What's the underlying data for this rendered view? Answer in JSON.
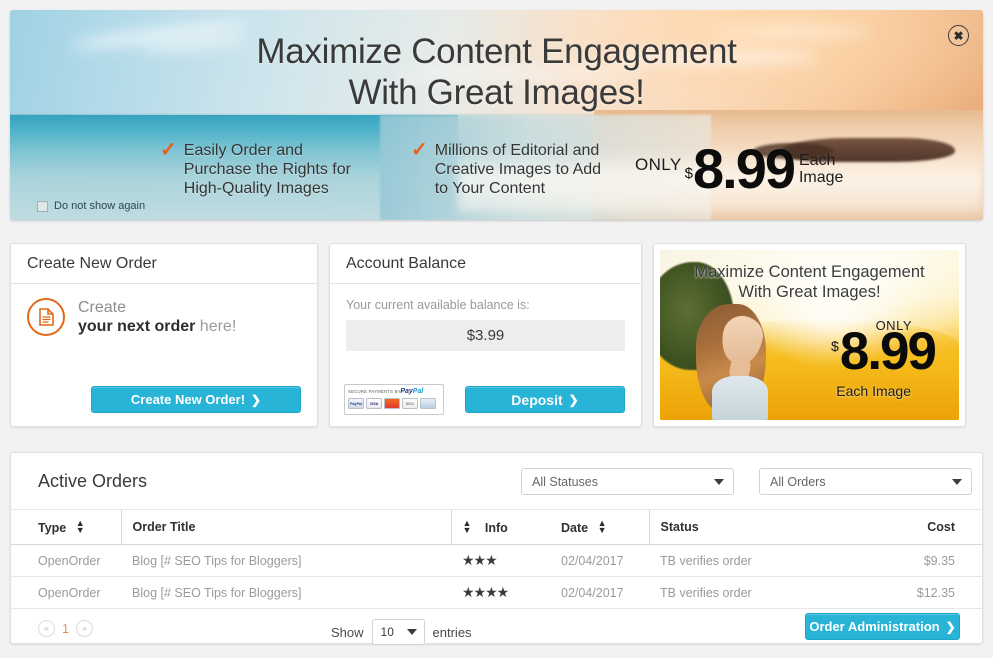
{
  "banner": {
    "headline_line1": "Maximize Content Engagement",
    "headline_line2": "With Great Images!",
    "bullets": [
      "Easily Order and\nPurchase the Rights for\nHigh-Quality Images",
      "Millions of Editorial and\nCreative Images to Add\nto Your Content"
    ],
    "only_label": "ONLY",
    "dollar_sign": "$",
    "price": "8.99",
    "each_line1": "Each",
    "each_line2": "Image",
    "close_icon": "close-icon",
    "do_not_show_again": "Do not show again"
  },
  "create_order_card": {
    "title": "Create New Order",
    "icon": "document-icon",
    "line1": "Create",
    "line2_strong": "your next order",
    "line2_soft": " here!",
    "button_label": "Create New Order!",
    "button_chevron": "❯",
    "accent_color": "#e2691a",
    "button_color": "#28b4d7"
  },
  "account_balance_card": {
    "title": "Account Balance",
    "label": "Your current available balance is:",
    "balance": "$3.99",
    "button_label": "Deposit",
    "button_chevron": "❯",
    "paypal": {
      "secure_text": "SECURE PAYMENTS BY",
      "logo_pay": "Pay",
      "logo_pal": "Pal",
      "cards": [
        "PayPal",
        "VISA",
        "MC",
        "DISC",
        "AMEX"
      ]
    }
  },
  "promo_card": {
    "headline_line1": "Maximize Content Engagement",
    "headline_line2": "With Great Images!",
    "only_label": "ONLY",
    "dollar_sign": "$",
    "price": "8.99",
    "each_image": "Each Image"
  },
  "active_orders": {
    "title": "Active Orders",
    "filters": [
      {
        "name": "status-filter",
        "value": "All Statuses"
      },
      {
        "name": "orders-filter",
        "value": "All Orders"
      }
    ],
    "columns": [
      "Type",
      "Order Title",
      "Info",
      "Date",
      "Status",
      "Cost"
    ],
    "rows": [
      {
        "type": "OpenOrder",
        "title": "Blog [# SEO Tips for Bloggers]",
        "stars": 3,
        "date": "02/04/2017",
        "status": "TB verifies order",
        "cost": "$9.35"
      },
      {
        "type": "OpenOrder",
        "title": "Blog [# SEO Tips for Bloggers]",
        "stars": 4,
        "date": "02/04/2017",
        "status": "TB verifies order",
        "cost": "$12.35"
      }
    ],
    "pagination": {
      "prev": "«",
      "page": "1",
      "next": "»"
    },
    "show_label": "Show",
    "entries_value": "10",
    "entries_label": "entries",
    "admin_button_label": "Order Administration",
    "admin_button_chevron": "❯"
  }
}
